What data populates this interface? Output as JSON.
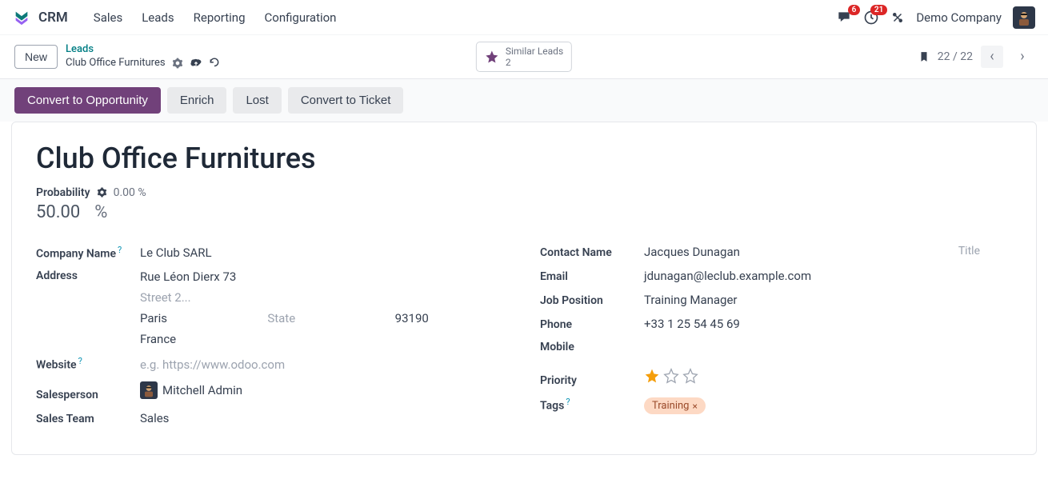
{
  "nav": {
    "app": "CRM",
    "items": [
      "Sales",
      "Leads",
      "Reporting",
      "Configuration"
    ],
    "messages_badge": "6",
    "activities_badge": "21",
    "company": "Demo Company"
  },
  "actionbar": {
    "new_btn": "New",
    "crumb_top": "Leads",
    "crumb_current": "Club Office Furnitures",
    "similar_label": "Similar Leads",
    "similar_count": "2",
    "pager": "22 / 22"
  },
  "buttons": {
    "convert_opp": "Convert to Opportunity",
    "enrich": "Enrich",
    "lost": "Lost",
    "convert_ticket": "Convert to Ticket"
  },
  "form": {
    "title": "Club Office Furnitures",
    "probability_label": "Probability",
    "probability_auto": "0.00 %",
    "probability_value": "50.00",
    "percent_symbol": "%",
    "left": {
      "company_name_label": "Company Name",
      "company_name": "Le Club SARL",
      "address_label": "Address",
      "street1": "Rue Léon Dierx 73",
      "street2_placeholder": "Street 2...",
      "city": "Paris",
      "state_placeholder": "State",
      "zip": "93190",
      "country": "France",
      "website_label": "Website",
      "website_placeholder": "e.g. https://www.odoo.com",
      "salesperson_label": "Salesperson",
      "salesperson": "Mitchell Admin",
      "sales_team_label": "Sales Team",
      "sales_team": "Sales"
    },
    "right": {
      "contact_name_label": "Contact Name",
      "contact_name": "Jacques Dunagan",
      "title_placeholder": "Title",
      "email_label": "Email",
      "email": "jdunagan@leclub.example.com",
      "job_label": "Job Position",
      "job": "Training Manager",
      "phone_label": "Phone",
      "phone": "+33 1 25 54 45 69",
      "mobile_label": "Mobile",
      "priority_label": "Priority",
      "tags_label": "Tags",
      "tag": "Training"
    }
  }
}
